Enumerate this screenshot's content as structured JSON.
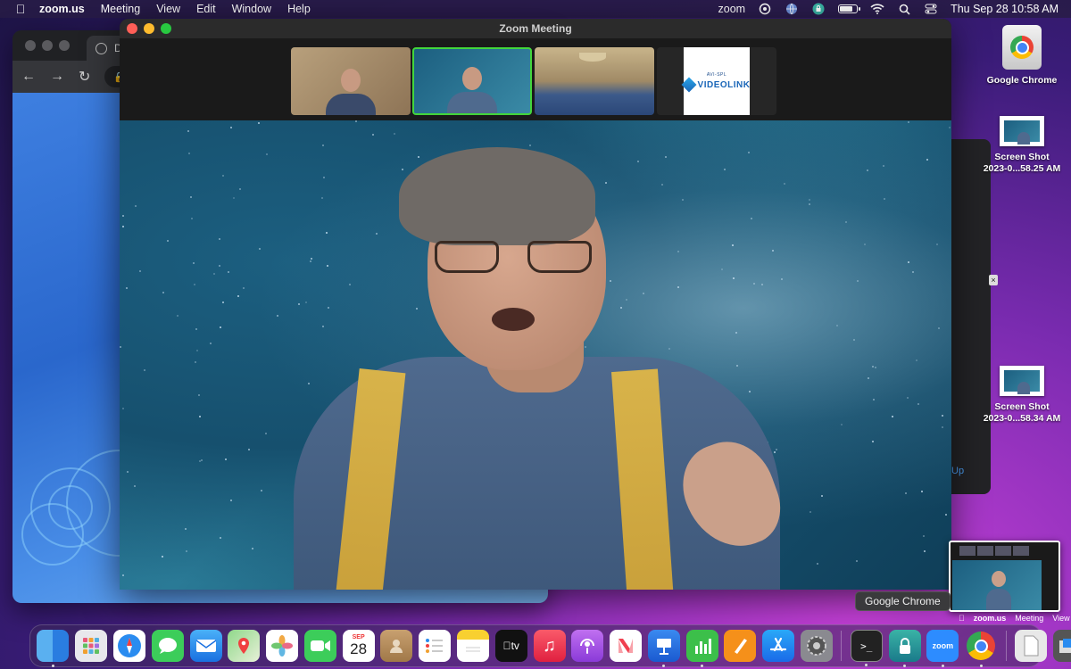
{
  "menubar": {
    "app_name": "zoom.us",
    "items": [
      "Meeting",
      "View",
      "Edit",
      "Window",
      "Help"
    ],
    "status_zoom": "zoom",
    "clock": "Thu Sep 28  10:58 AM",
    "battery_fill": 0.85
  },
  "chrome_window": {
    "tab_title": "Du"
  },
  "zoom_window": {
    "title": "Zoom Meeting",
    "videolink_small": "AVI-SPL",
    "videolink_text": "VIDEOLINK"
  },
  "side_panel": {
    "label": "Up"
  },
  "desktop": {
    "icons": [
      {
        "label_line1": "Google Chrome",
        "label_line2": ""
      },
      {
        "label_line1": "Screen Shot",
        "label_line2": "2023-0...58.25 AM"
      },
      {
        "label_line1": "Screen Shot",
        "label_line2": "2023-0...58.34 AM"
      }
    ]
  },
  "preview_menubar": {
    "app_name": "zoom.us",
    "items": [
      "Meeting",
      "View"
    ]
  },
  "tooltip": "Google Chrome",
  "dock": {
    "calendar_month": "SEP",
    "calendar_day": "28",
    "tv_label": "tv",
    "zoom_label": "zoom"
  },
  "colors": {
    "active_speaker_border": "#43d63b",
    "close": "#ff5f57",
    "minimize": "#febc2e",
    "maximize": "#28c840"
  }
}
